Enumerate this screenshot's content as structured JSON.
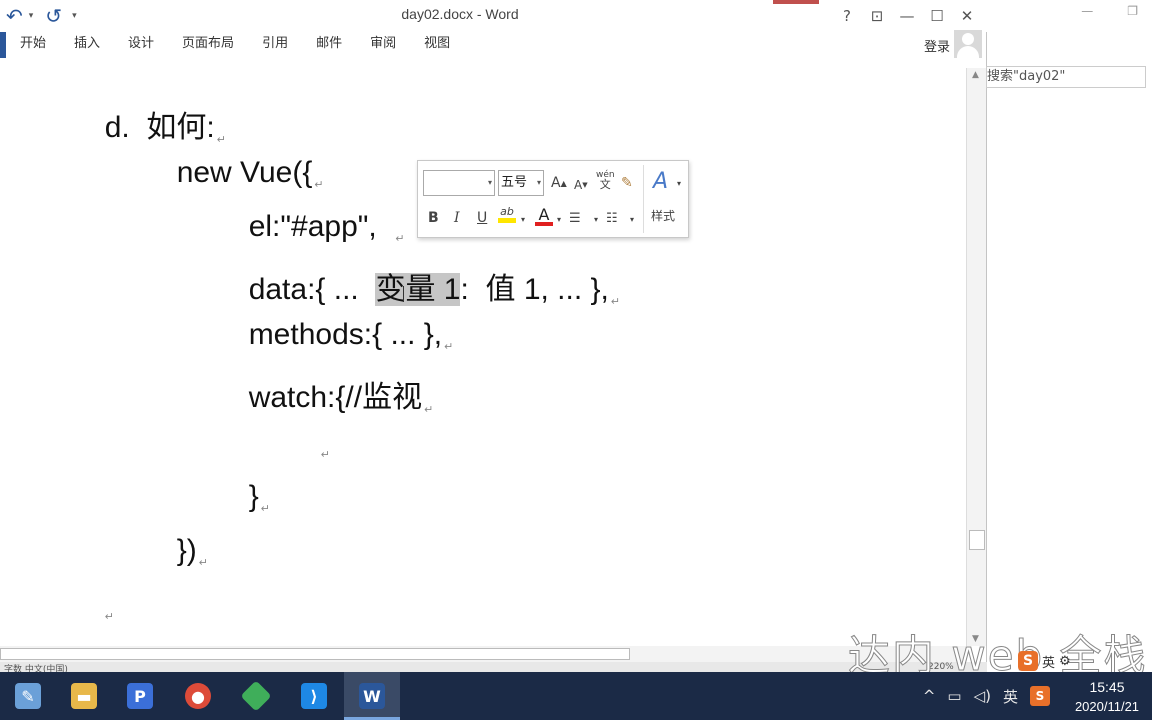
{
  "window": {
    "title": "day02.docx - Word",
    "help": "?",
    "ribbon_display": "⊡",
    "minimize": "—",
    "maximize": "☐",
    "close": "✕"
  },
  "qat": {
    "undo": "↶",
    "redo": "↺",
    "customize": "▾"
  },
  "ribbon": {
    "tabs": [
      "开始",
      "插入",
      "设计",
      "页面布局",
      "引用",
      "邮件",
      "审阅",
      "视图"
    ],
    "signin": "登录"
  },
  "document": {
    "lines": [
      {
        "text": "d.  如何:"
      },
      {
        "text": "new Vue({"
      },
      {
        "text": "el:\"#app\",  "
      },
      {
        "pre": "data:{ ...  ",
        "selected": "变量 1",
        "post": ":  值 1, ... },"
      },
      {
        "text": "methods:{ ... },"
      },
      {
        "text": "watch:{//监视"
      },
      {
        "text": ""
      },
      {
        "text": "}"
      },
      {
        "text": "})"
      },
      {
        "text": ""
      }
    ],
    "paragraph_mark": "↵"
  },
  "mini_toolbar": {
    "font_name": "",
    "font_size": "五号",
    "grow_font": "A",
    "shrink_font": "A",
    "phonetic_top": "wén",
    "phonetic_bottom": "文",
    "bold": "B",
    "italic": "I",
    "underline": "U",
    "highlight": "ab",
    "font_color": "A",
    "styles_label": "样式",
    "highlight_color": "#ffe600",
    "font_color_value": "#e02020"
  },
  "right_panel": {
    "search_text": "搜索\"day02\"",
    "minimize": "—",
    "restore": "❐"
  },
  "status_bar": {
    "left_text": "字数  中文(中国)",
    "zoom": "220%"
  },
  "watermark": "达内 web 全栈",
  "ime": {
    "mode": "英"
  },
  "taskbar": {
    "apps": [
      {
        "name": "Paint",
        "icon": "🎨",
        "color": "#6ba0d8"
      },
      {
        "name": "File Explorer",
        "icon": "📁",
        "color": "#e8b84a"
      },
      {
        "name": "P",
        "icon": "P",
        "color": "#3b6fd8"
      },
      {
        "name": "Chrome",
        "icon": "●",
        "color": "#dd4b39"
      },
      {
        "name": "App",
        "icon": "◆",
        "color": "#3fae5a"
      },
      {
        "name": "VS Code",
        "icon": "⟩",
        "color": "#1e88e5"
      },
      {
        "name": "Word",
        "icon": "W",
        "color": "#2b579a"
      }
    ],
    "tray_lang": "英",
    "time": "15:45",
    "date": "2020/11/21"
  }
}
